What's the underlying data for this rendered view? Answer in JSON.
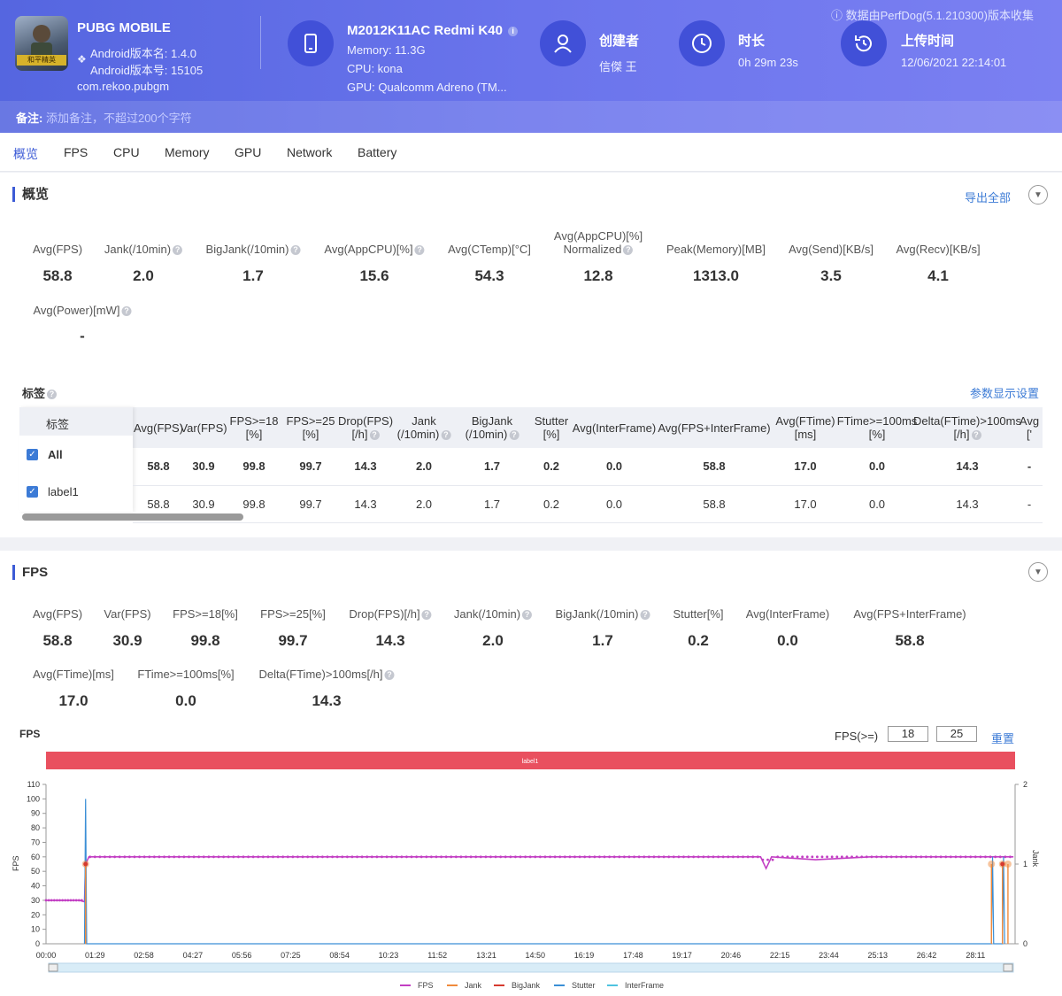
{
  "header": {
    "notice": "ⓘ 数据由PerfDog(5.1.210300)版本收集",
    "app": {
      "name": "PUBG MOBILE",
      "icon_text": "和平精英",
      "version_name": "Android版本名: 1.4.0",
      "version_code": "Android版本号: 15105",
      "package": "com.rekoo.pubgm"
    },
    "device": {
      "title": "M2012K11AC Redmi K40",
      "memory": "Memory: 11.3G",
      "cpu": "CPU: kona",
      "gpu": "GPU: Qualcomm Adreno (TM..."
    },
    "creator": {
      "title": "创建者",
      "value": "信傑 王"
    },
    "duration": {
      "title": "时长",
      "value": "0h 29m 23s"
    },
    "upload": {
      "title": "上传时间",
      "value": "12/06/2021 22:14:01"
    },
    "note_label": "备注:",
    "note_placeholder": "添加备注，不超过200个字符"
  },
  "tabs": [
    "概览",
    "FPS",
    "CPU",
    "Memory",
    "GPU",
    "Network",
    "Battery"
  ],
  "overview": {
    "title": "概览",
    "export": "导出全部",
    "metrics": [
      {
        "label": "Avg(FPS)",
        "value": "58.8"
      },
      {
        "label": "Jank(/10min)",
        "value": "2.0"
      },
      {
        "label": "BigJank(/10min)",
        "value": "1.7"
      },
      {
        "label": "Avg(AppCPU)[%]",
        "value": "15.6"
      },
      {
        "label": "Avg(CTemp)[°C]",
        "value": "54.3"
      },
      {
        "label": "Avg(AppCPU)[%]",
        "label2": "Normalized",
        "value": "12.8"
      },
      {
        "label": "Peak(Memory)[MB]",
        "value": "1313.0"
      },
      {
        "label": "Avg(Send)[KB/s]",
        "value": "3.5"
      },
      {
        "label": "Avg(Recv)[KB/s]",
        "value": "4.1"
      },
      {
        "label": "Avg(Power)[mW]",
        "value": "-"
      }
    ]
  },
  "labels": {
    "title": "标签",
    "settings": "参数显示设置",
    "col_label": "标签",
    "columns": [
      {
        "l1": "Avg(FPS)",
        "l2": ""
      },
      {
        "l1": "Var(FPS)",
        "l2": ""
      },
      {
        "l1": "FPS>=18",
        "l2": "[%]"
      },
      {
        "l1": "FPS>=25",
        "l2": "[%]"
      },
      {
        "l1": "Drop(FPS)",
        "l2": "[/h]"
      },
      {
        "l1": "Jank",
        "l2": "(/10min)"
      },
      {
        "l1": "BigJank",
        "l2": "(/10min)"
      },
      {
        "l1": "Stutter",
        "l2": "[%]"
      },
      {
        "l1": "Avg(InterFrame)",
        "l2": ""
      },
      {
        "l1": "Avg(FPS+InterFrame)",
        "l2": ""
      },
      {
        "l1": "Avg(FTime)",
        "l2": "[ms]"
      },
      {
        "l1": "FTime>=100ms",
        "l2": "[%]"
      },
      {
        "l1": "Delta(FTime)>100ms",
        "l2": "[/h]"
      },
      {
        "l1": "Avg",
        "l2": "['"
      }
    ],
    "rows": [
      {
        "name": "All",
        "values": [
          "58.8",
          "30.9",
          "99.8",
          "99.7",
          "14.3",
          "2.0",
          "1.7",
          "0.2",
          "0.0",
          "58.8",
          "17.0",
          "0.0",
          "14.3",
          "-"
        ]
      },
      {
        "name": "label1",
        "values": [
          "58.8",
          "30.9",
          "99.8",
          "99.7",
          "14.3",
          "2.0",
          "1.7",
          "0.2",
          "0.0",
          "58.8",
          "17.0",
          "0.0",
          "14.3",
          "-"
        ]
      }
    ]
  },
  "fps": {
    "title": "FPS",
    "metrics": [
      {
        "label": "Avg(FPS)",
        "value": "58.8"
      },
      {
        "label": "Var(FPS)",
        "value": "30.9"
      },
      {
        "label": "FPS>=18[%]",
        "value": "99.8"
      },
      {
        "label": "FPS>=25[%]",
        "value": "99.7"
      },
      {
        "label": "Drop(FPS)[/h]",
        "value": "14.3"
      },
      {
        "label": "Jank(/10min)",
        "value": "2.0"
      },
      {
        "label": "BigJank(/10min)",
        "value": "1.7"
      },
      {
        "label": "Stutter[%]",
        "value": "0.2"
      },
      {
        "label": "Avg(InterFrame)",
        "value": "0.0"
      },
      {
        "label": "Avg(FPS+InterFrame)",
        "value": "58.8"
      },
      {
        "label": "Avg(FTime)[ms]",
        "value": "17.0"
      },
      {
        "label": "FTime>=100ms[%]",
        "value": "0.0"
      },
      {
        "label": "Delta(FTime)>100ms[/h]",
        "value": "14.3"
      }
    ],
    "chart_title": "FPS",
    "threshold_label": "FPS(>=)",
    "threshold_1": "18",
    "threshold_2": "25",
    "reset": "重置"
  },
  "chart_data": {
    "type": "line",
    "title": "FPS",
    "label_band": "label1",
    "ylabel": "FPS",
    "y2label": "Jank",
    "ylim": [
      0,
      110
    ],
    "y2lim": [
      0,
      2
    ],
    "yticks": [
      "0",
      "10",
      "20",
      "30",
      "40",
      "50",
      "60",
      "70",
      "80",
      "90",
      "100",
      "110"
    ],
    "y2ticks": [
      "0",
      "1",
      "2"
    ],
    "xticks": [
      "00:00",
      "01:29",
      "02:58",
      "04:27",
      "05:56",
      "07:25",
      "08:54",
      "10:23",
      "11:52",
      "13:21",
      "14:50",
      "16:19",
      "17:48",
      "19:17",
      "20:46",
      "22:15",
      "23:44",
      "25:13",
      "26:42",
      "28:11"
    ],
    "x_range_seconds": [
      0,
      1763
    ],
    "series": [
      {
        "name": "FPS",
        "color": "#c23ec3",
        "points": [
          [
            0,
            30
          ],
          [
            30,
            30
          ],
          [
            60,
            30
          ],
          [
            70,
            29
          ],
          [
            72,
            55
          ],
          [
            78,
            60
          ],
          [
            200,
            60
          ],
          [
            400,
            60
          ],
          [
            600,
            60
          ],
          [
            800,
            60
          ],
          [
            1000,
            60
          ],
          [
            1300,
            60
          ],
          [
            1310,
            52
          ],
          [
            1320,
            60
          ],
          [
            1400,
            58
          ],
          [
            1500,
            60
          ],
          [
            1700,
            60
          ],
          [
            1760,
            60
          ]
        ]
      },
      {
        "name": "Jank",
        "color": "#f08a3c",
        "points": [
          [
            72,
            1
          ],
          [
            1720,
            1
          ],
          [
            1740,
            1
          ],
          [
            1750,
            1
          ]
        ]
      },
      {
        "name": "BigJank",
        "color": "#d63b2f",
        "points": [
          [
            72,
            1
          ],
          [
            1740,
            1
          ]
        ]
      },
      {
        "name": "Stutter",
        "color": "#3b8fd6",
        "points": [
          [
            70,
            0
          ],
          [
            72,
            100
          ],
          [
            74,
            0
          ],
          [
            1720,
            0
          ],
          [
            1722,
            60
          ],
          [
            1724,
            0
          ],
          [
            1740,
            0
          ],
          [
            1742,
            60
          ],
          [
            1744,
            0
          ]
        ]
      },
      {
        "name": "InterFrame",
        "color": "#4ec3e0",
        "points": []
      }
    ]
  }
}
